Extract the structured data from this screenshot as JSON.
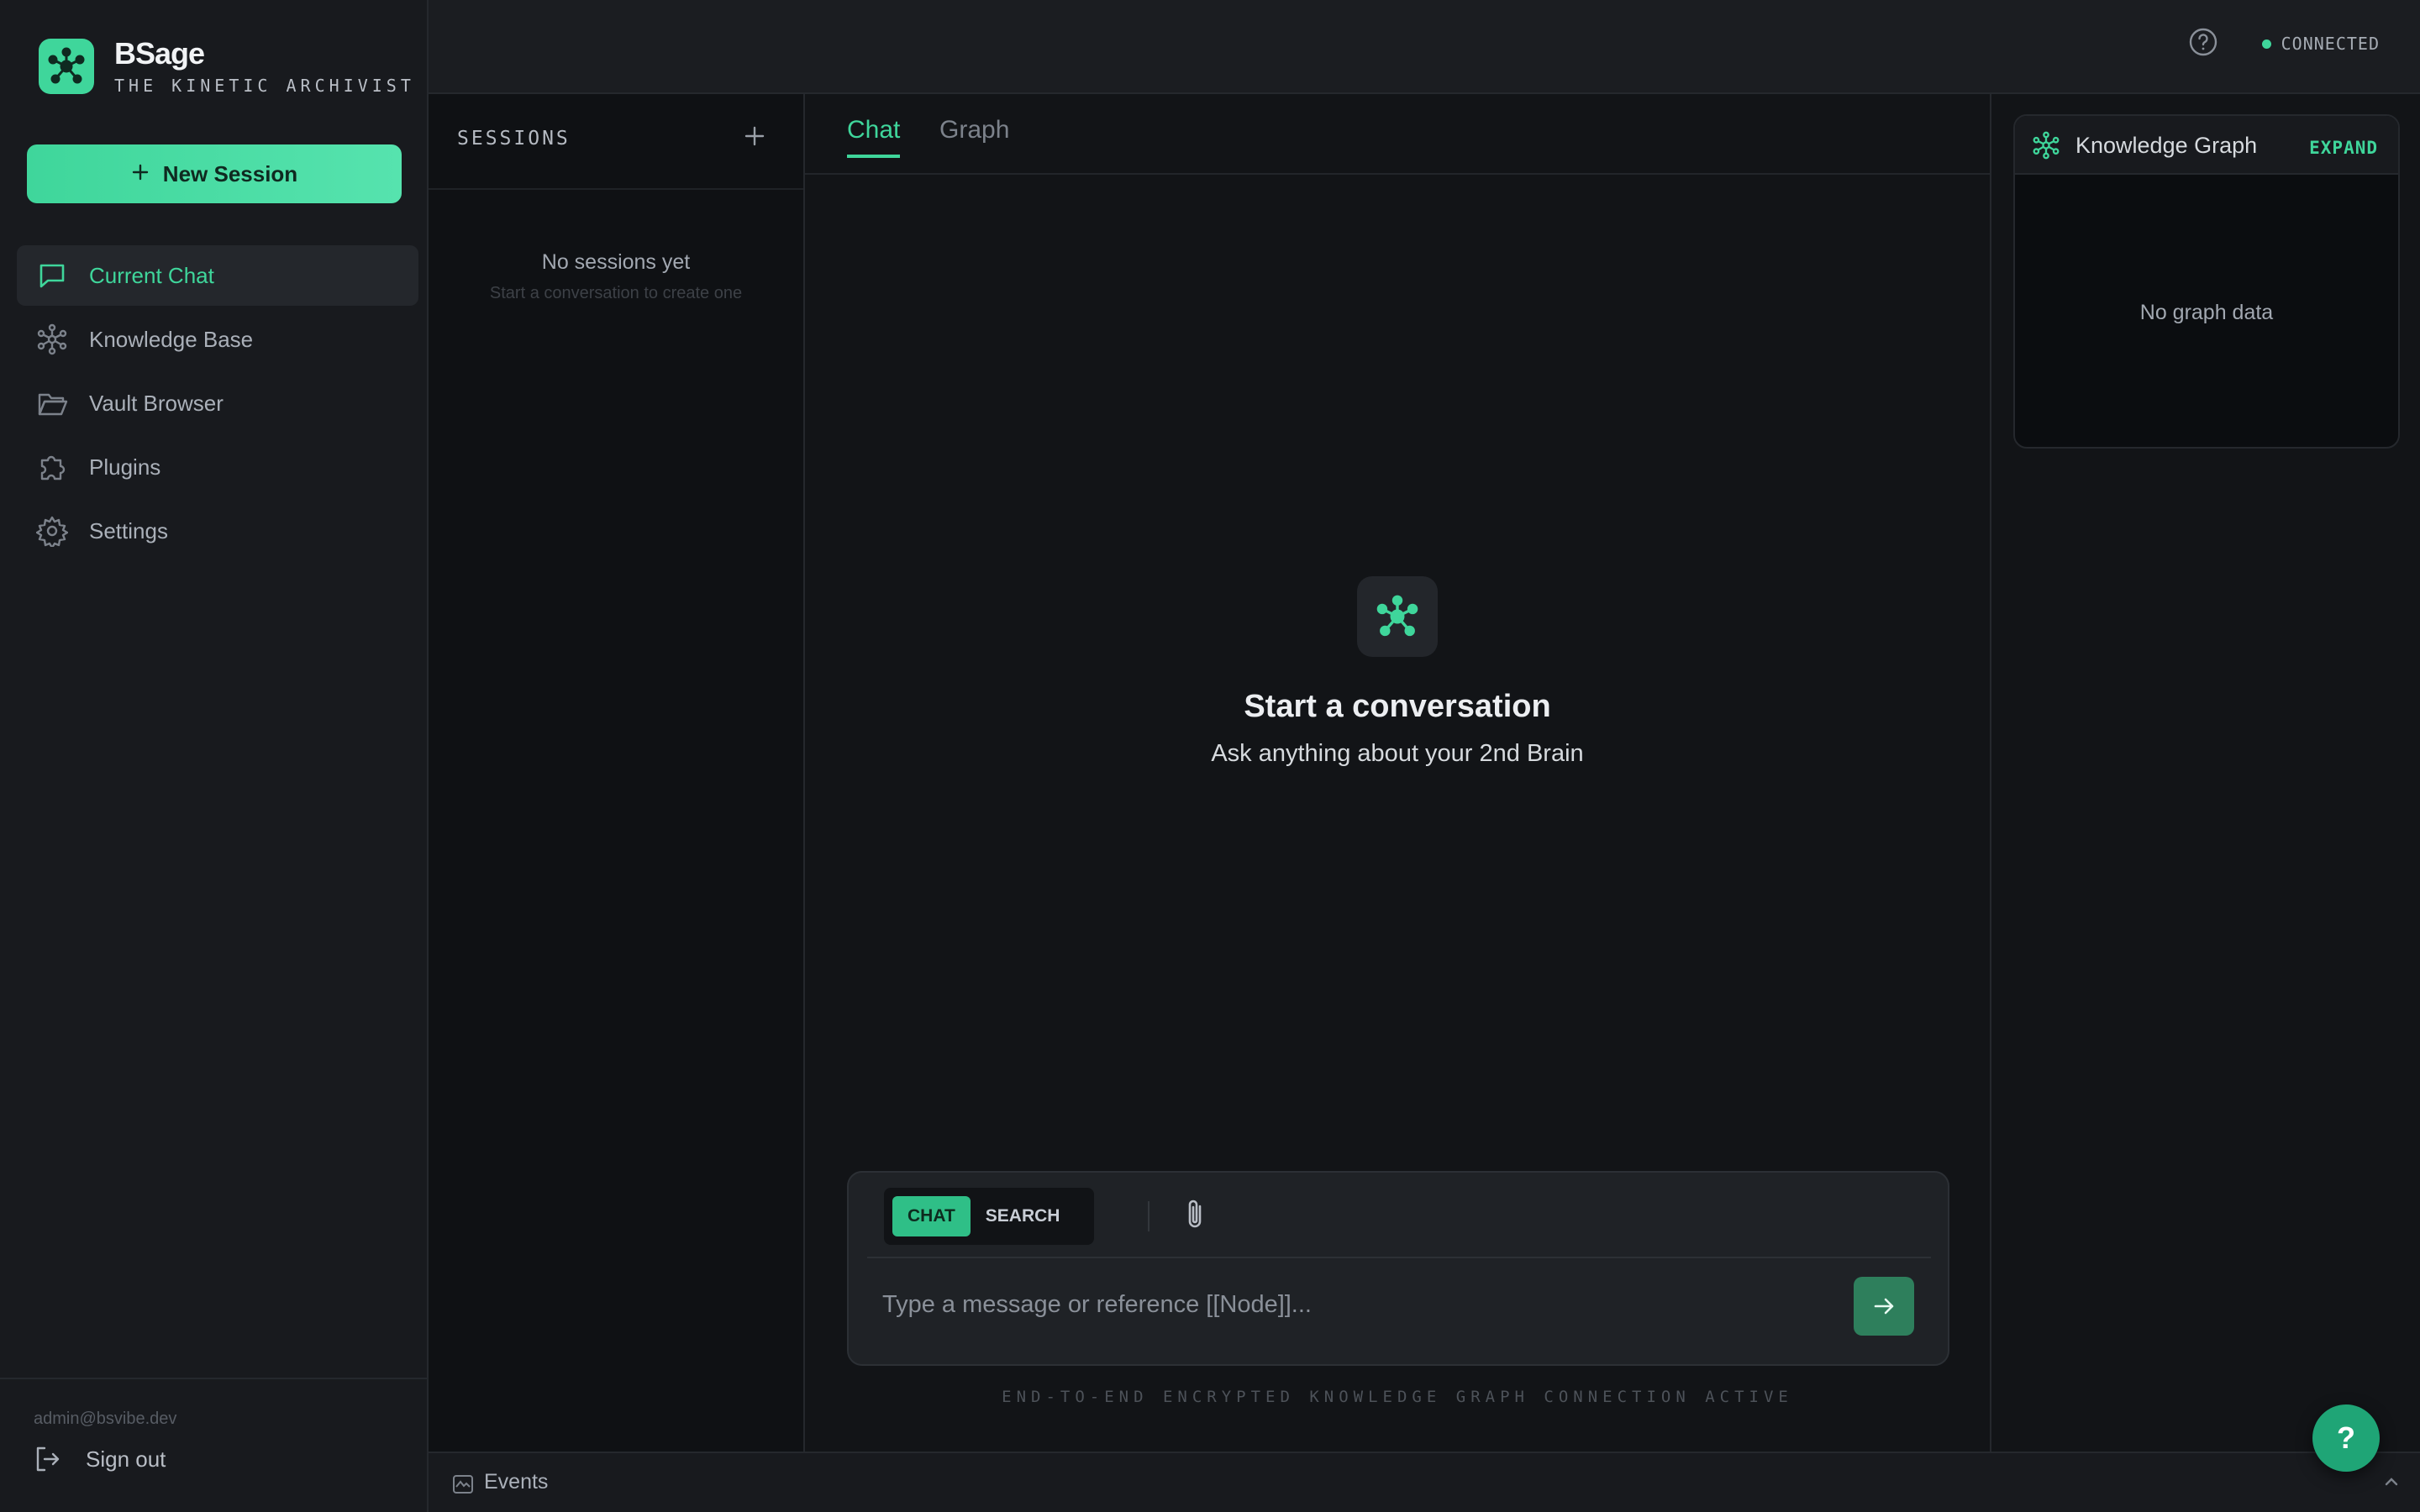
{
  "brand": {
    "name": "BSage",
    "tagline": "THE KINETIC ARCHIVIST"
  },
  "sidebar": {
    "new_session_label": "New Session",
    "items": [
      {
        "label": "Current Chat",
        "icon": "chat-bubble-icon",
        "active": true
      },
      {
        "label": "Knowledge Base",
        "icon": "graph-nodes-icon",
        "active": false
      },
      {
        "label": "Vault Browser",
        "icon": "folder-icon",
        "active": false
      },
      {
        "label": "Plugins",
        "icon": "puzzle-icon",
        "active": false
      },
      {
        "label": "Settings",
        "icon": "gear-icon",
        "active": false
      }
    ],
    "user_email": "admin@bsvibe.dev",
    "signout_label": "Sign out"
  },
  "topbar": {
    "status_text": "CONNECTED"
  },
  "sessions": {
    "title": "SESSIONS",
    "empty_title": "No sessions yet",
    "empty_hint": "Start a conversation to create one"
  },
  "main": {
    "tabs": [
      {
        "label": "Chat",
        "active": true
      },
      {
        "label": "Graph",
        "active": false
      }
    ],
    "empty_title": "Start a conversation",
    "empty_subtitle": "Ask anything about your 2nd Brain",
    "composer": {
      "modes": [
        "CHAT",
        "SEARCH"
      ],
      "active_mode": "CHAT",
      "placeholder": "Type a message or reference [[Node]]..."
    },
    "footer_note": "END-TO-END ENCRYPTED KNOWLEDGE GRAPH CONNECTION ACTIVE"
  },
  "knowledge_graph": {
    "title": "Knowledge Graph",
    "expand_label": "EXPAND",
    "empty_text": "No graph data"
  },
  "events": {
    "label": "Events"
  },
  "help_fab": {
    "label": "?"
  },
  "colors": {
    "accent": "#3fd69b",
    "background": "#121417",
    "sidebar": "#181a1e"
  }
}
